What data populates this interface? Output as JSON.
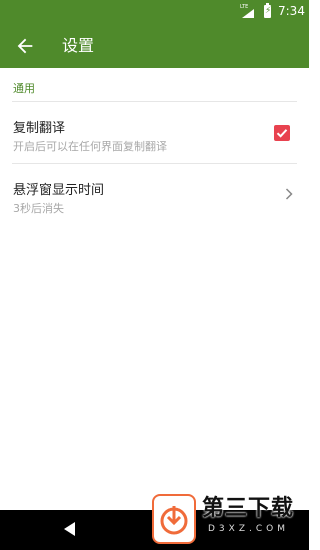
{
  "status_bar": {
    "network_label": "LTE",
    "time": "7:34",
    "signal_icon": "signal-icon",
    "battery_icon": "battery-charging-icon"
  },
  "app_bar": {
    "back_icon": "arrow-back-icon",
    "title": "设置",
    "color": "#4f8a2b"
  },
  "settings": {
    "section_title": "通用",
    "items": [
      {
        "label": "复制翻译",
        "summary": "开启后可以在任何界面复制翻译",
        "control": "checkbox",
        "checked": true
      },
      {
        "label": "悬浮窗显示时间",
        "summary": "3秒后消失",
        "control": "chevron-right-icon"
      }
    ]
  },
  "watermark": {
    "text": "第三下载",
    "domain": "D3XZ.COM"
  },
  "nav_bar": {
    "back_icon": "nav-back-icon"
  },
  "colors": {
    "accent": "#4f8a2b",
    "checkbox": "#e8424f"
  }
}
